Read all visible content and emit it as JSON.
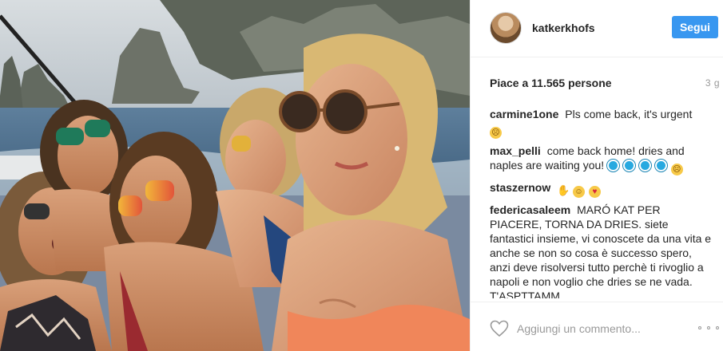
{
  "post": {
    "photo_icon": "group-selfie-photo",
    "author": "katkerkhofs",
    "follow_label": "Segui",
    "likes_text": "Piace a 11.565 persone",
    "time_ago": "3 g"
  },
  "comments": [
    {
      "author": "carmine1one",
      "text": "Pls come back, it's urgent",
      "emojis": [
        "sad"
      ]
    },
    {
      "author": "max_pelli",
      "text": "come back home! dries and naples are waiting you!",
      "emojis": [
        "blue-circle",
        "blue-circle",
        "blue-circle",
        "blue-circle",
        "sad"
      ]
    },
    {
      "author": "staszernow",
      "text": "",
      "emojis": [
        "hand",
        "grin",
        "heart-eyes"
      ]
    },
    {
      "author": "federicasaleem",
      "text": "MARÓ KAT PER PIACERE, TORNA DA DRIES. siete fantastici insieme, vi conoscete da una vita e anche se non so cosa è successo spero, anzi deve risolversi tutto perchè ti rivoglio a napoli e non voglio che dries se ne vada. T'ASPTTAMM",
      "emojis": []
    }
  ],
  "footer": {
    "comment_placeholder": "Aggiungi un commento...",
    "like_icon": "heart-icon",
    "more_icon": "more-options-icon"
  },
  "colors": {
    "accent": "#3897f0",
    "text": "#262626",
    "muted": "#999999",
    "border": "#efefef"
  }
}
